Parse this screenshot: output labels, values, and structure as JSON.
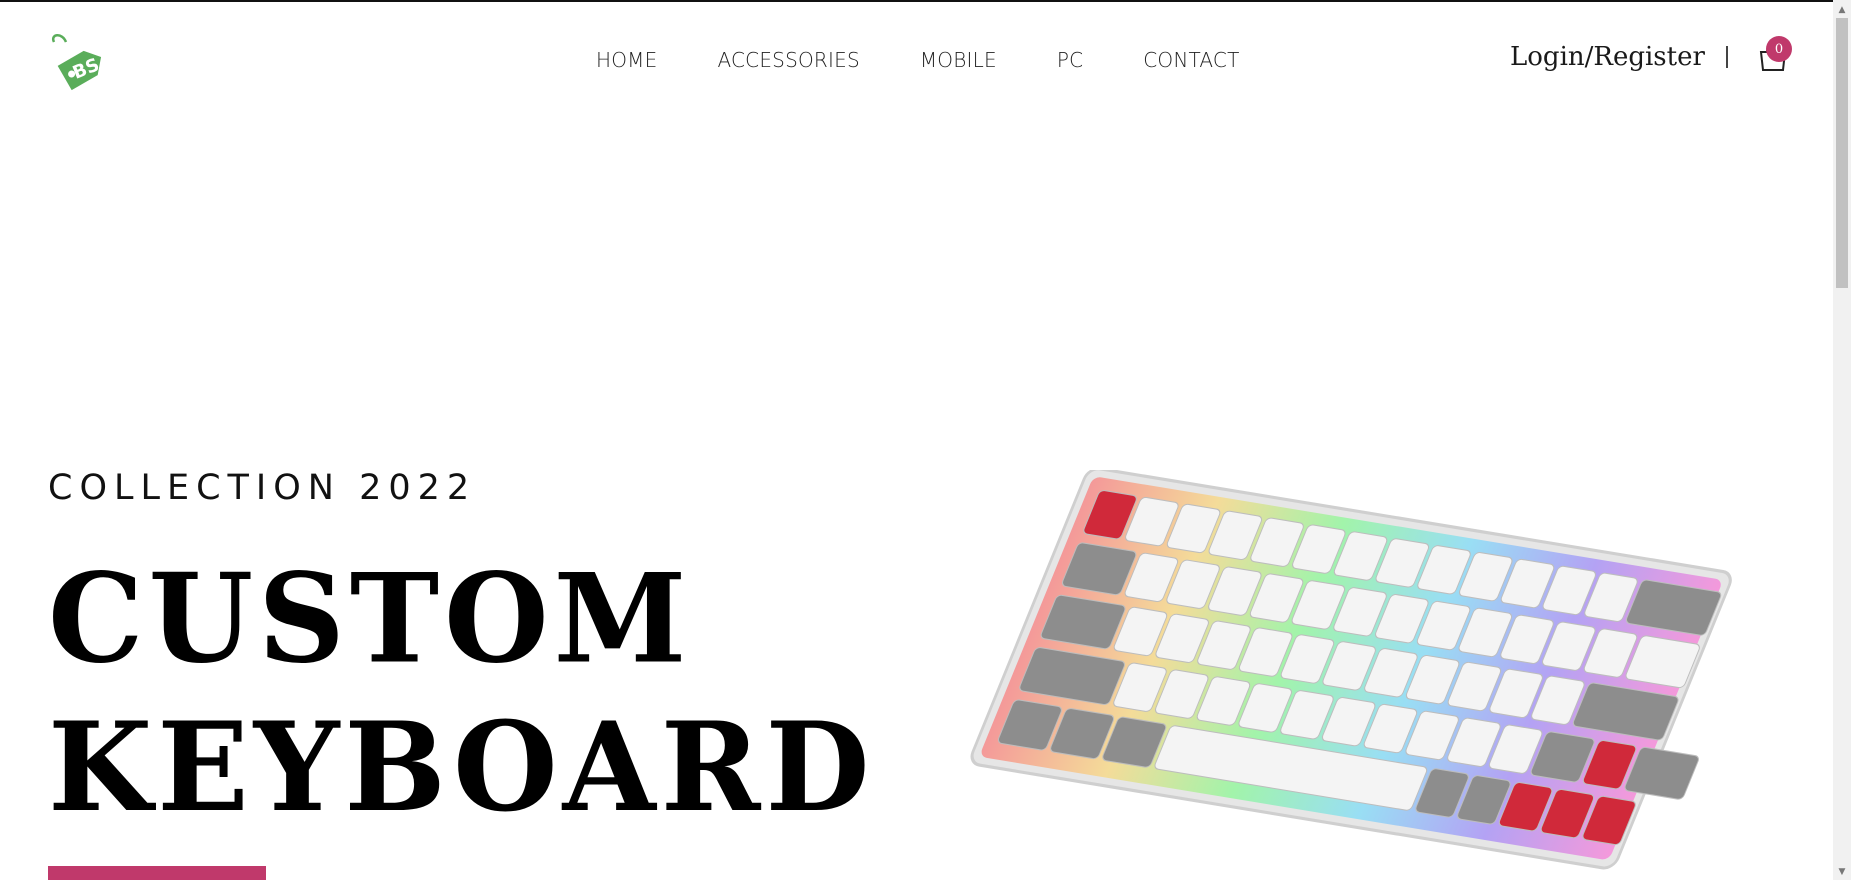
{
  "header": {
    "logo_text": "BS",
    "nav": [
      {
        "label": "HOME"
      },
      {
        "label": "ACCESSORIES"
      },
      {
        "label": "MOBILE"
      },
      {
        "label": "PC"
      },
      {
        "label": "CONTACT"
      }
    ],
    "login_label": "Login/Register",
    "divider": "|",
    "cart_count": "0"
  },
  "hero": {
    "eyebrow": "COLLECTION 2022",
    "title_line1": "CUSTOM",
    "title_line2": "KEYBOARD"
  },
  "colors": {
    "brand_green": "#5aad5a",
    "accent": "#c0396b",
    "text": "#111111"
  },
  "icons": {
    "logo": "price-tag-logo-icon",
    "cart": "shopping-bag-icon"
  }
}
